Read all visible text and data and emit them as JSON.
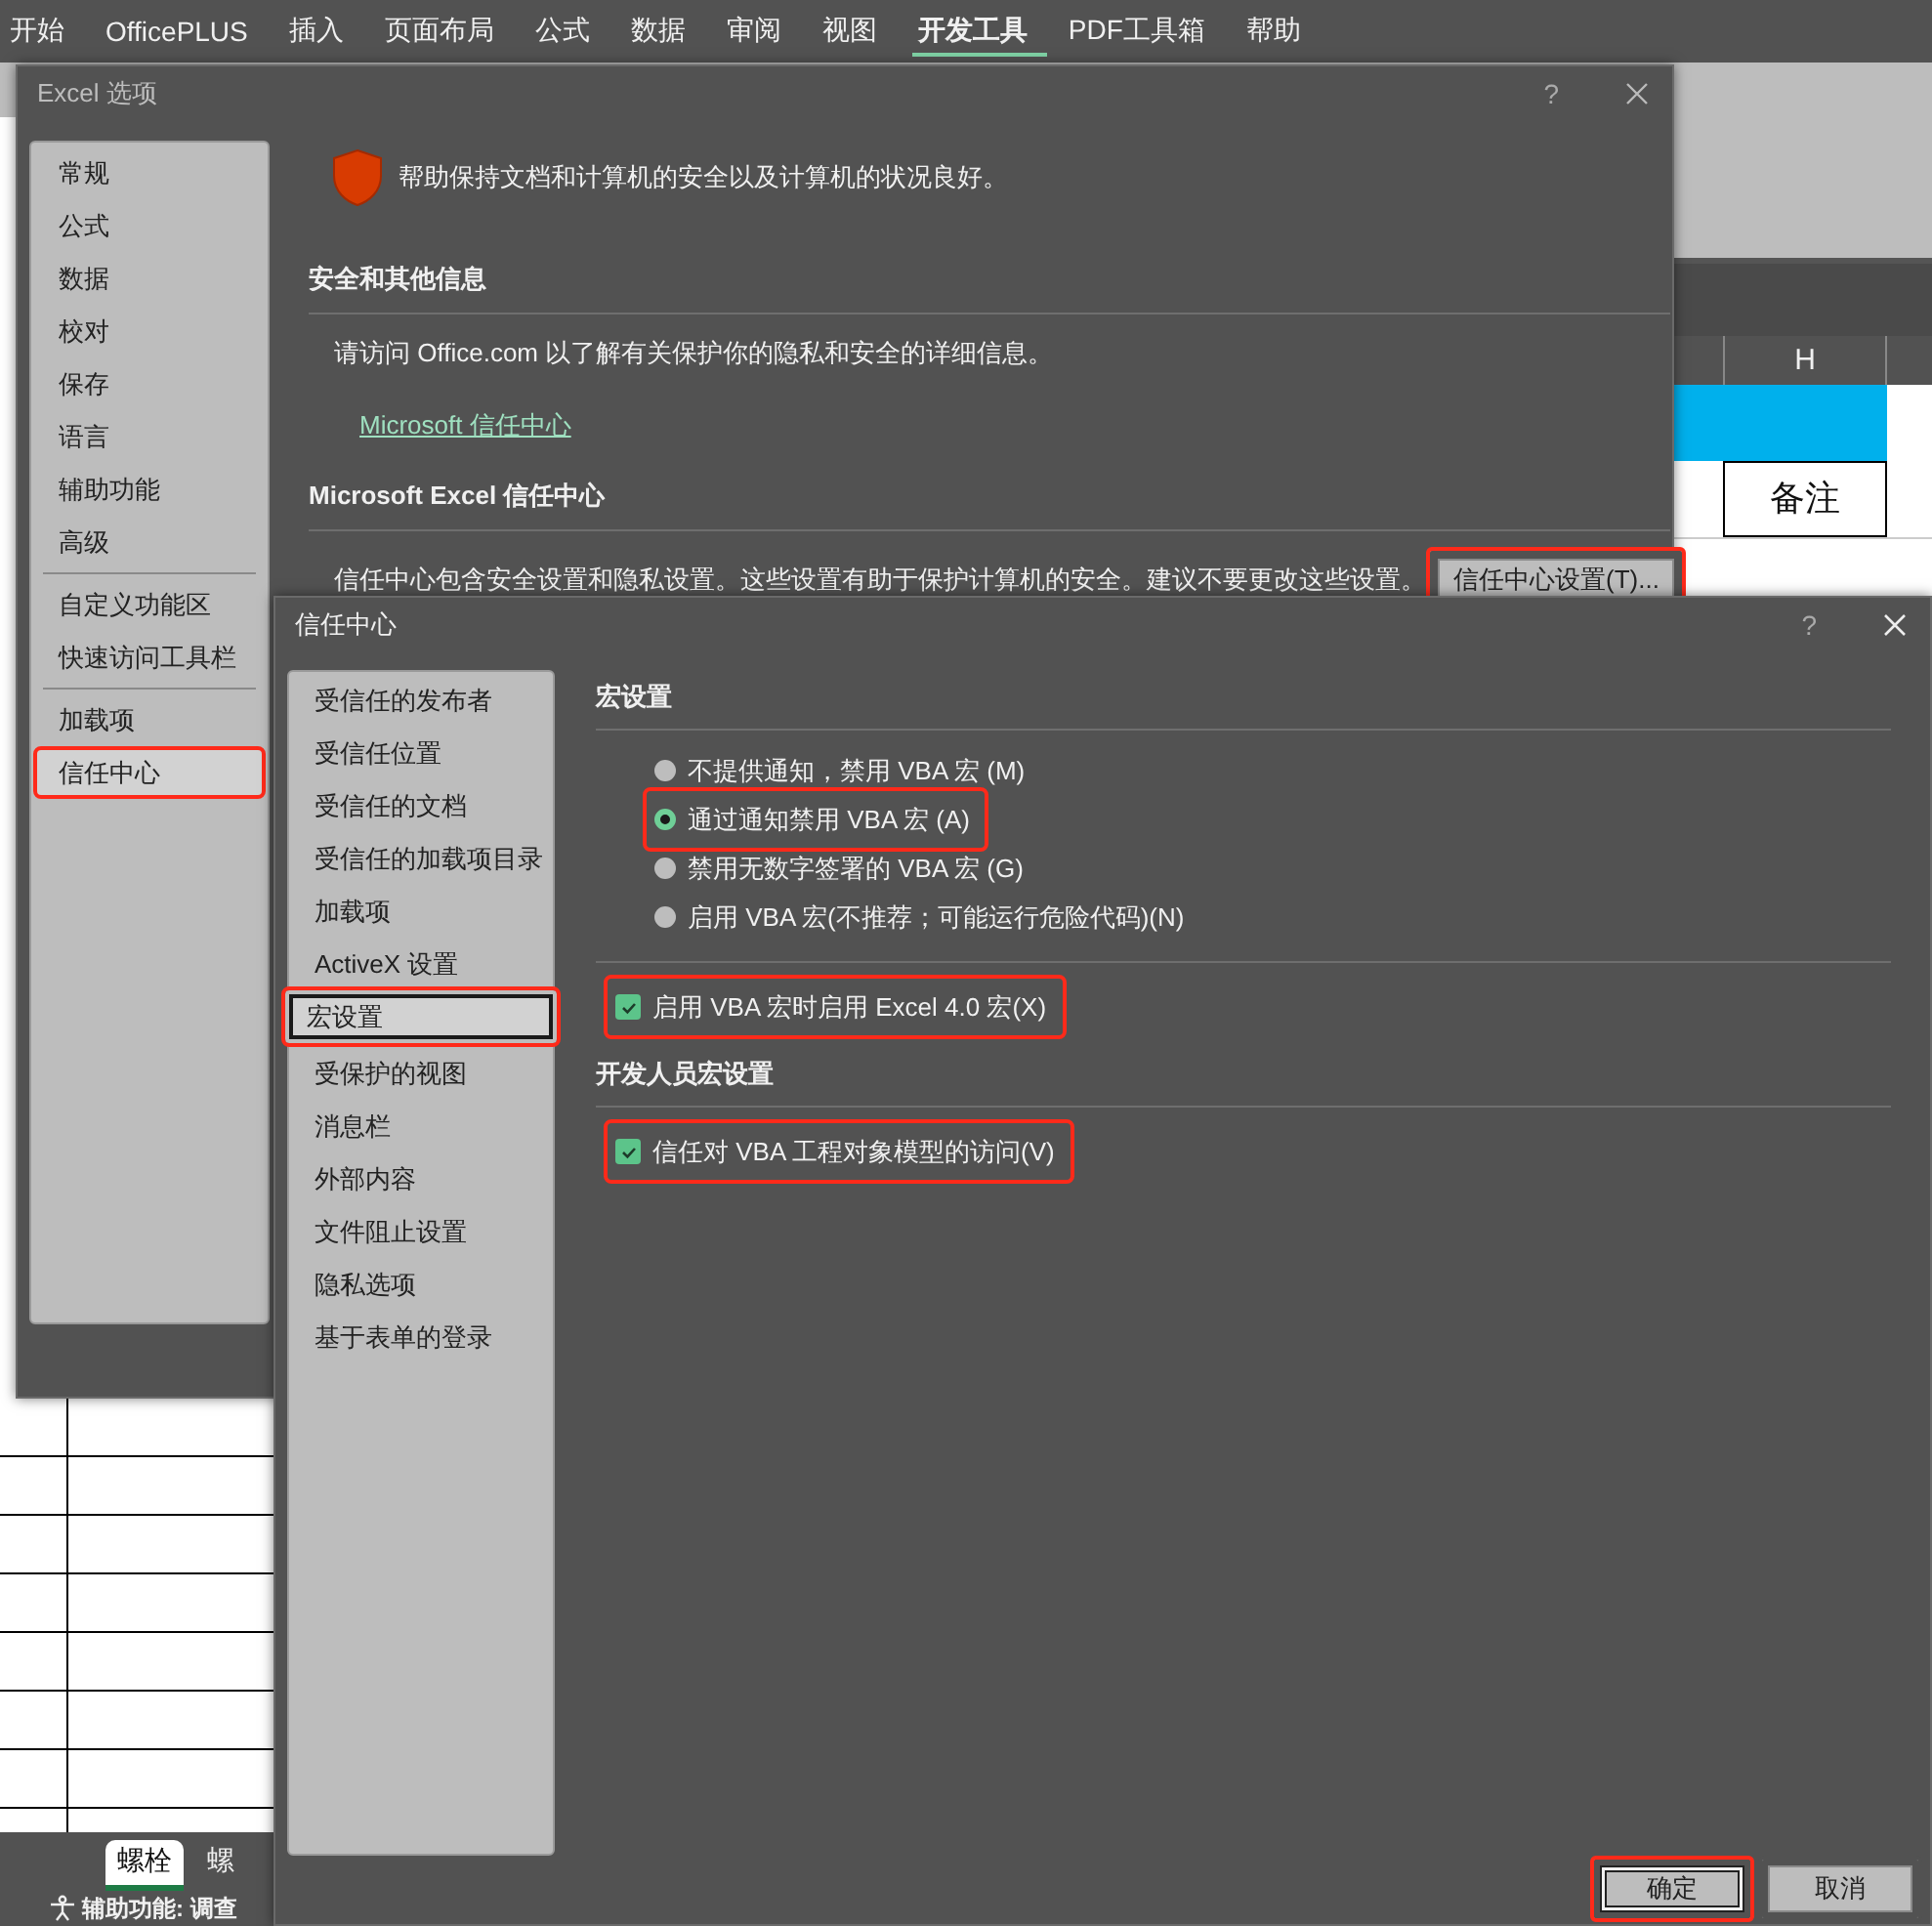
{
  "ribbon": {
    "tabs": [
      {
        "label": "开始",
        "selected": false
      },
      {
        "label": "OfficePLUS",
        "selected": false
      },
      {
        "label": "插入",
        "selected": false
      },
      {
        "label": "页面布局",
        "selected": false
      },
      {
        "label": "公式",
        "selected": false
      },
      {
        "label": "数据",
        "selected": false
      },
      {
        "label": "审阅",
        "selected": false
      },
      {
        "label": "视图",
        "selected": false
      },
      {
        "label": "开发工具",
        "selected": true
      },
      {
        "label": "PDF工具箱",
        "selected": false
      },
      {
        "label": "帮助",
        "selected": false
      }
    ]
  },
  "sheet": {
    "column_header": "H",
    "cell": "备注",
    "sheet_tabs": [
      {
        "label": "螺栓",
        "selected": true
      },
      {
        "label": "螺",
        "selected": false
      }
    ],
    "status_bar": "辅助功能: 调查"
  },
  "excel_options": {
    "title": "Excel 选项",
    "help": "?",
    "nav": [
      {
        "label": "常规",
        "selected": false,
        "highlighted": false,
        "separator_before": false
      },
      {
        "label": "公式",
        "selected": false,
        "highlighted": false,
        "separator_before": false
      },
      {
        "label": "数据",
        "selected": false,
        "highlighted": false,
        "separator_before": false
      },
      {
        "label": "校对",
        "selected": false,
        "highlighted": false,
        "separator_before": false
      },
      {
        "label": "保存",
        "selected": false,
        "highlighted": false,
        "separator_before": false
      },
      {
        "label": "语言",
        "selected": false,
        "highlighted": false,
        "separator_before": false
      },
      {
        "label": "辅助功能",
        "selected": false,
        "highlighted": false,
        "separator_before": false
      },
      {
        "label": "高级",
        "selected": false,
        "highlighted": false,
        "separator_before": false
      },
      {
        "label": "自定义功能区",
        "selected": false,
        "highlighted": false,
        "separator_before": true
      },
      {
        "label": "快速访问工具栏",
        "selected": false,
        "highlighted": false,
        "separator_before": false
      },
      {
        "label": "加载项",
        "selected": false,
        "highlighted": false,
        "separator_before": true
      },
      {
        "label": "信任中心",
        "selected": true,
        "highlighted": true,
        "separator_before": false
      }
    ],
    "banner": "帮助保持文档和计算机的安全以及计算机的状况良好。",
    "sections": [
      {
        "heading": "安全和其他信息",
        "text": "请访问 Office.com  以了解有关保护你的隐私和安全的详细信息。",
        "link": "Microsoft 信任中心"
      },
      {
        "heading": "Microsoft Excel 信任中心",
        "text": "信任中心包含安全设置和隐私设置。这些设置有助于保护计算机的安全。建议不要更改这些设置。",
        "button": {
          "label": "信任中心设置(T)...",
          "highlighted": true
        }
      }
    ]
  },
  "trust_center": {
    "title": "信任中心",
    "help": "?",
    "nav": [
      {
        "label": "受信任的发布者",
        "selected": false,
        "highlighted": false
      },
      {
        "label": "受信任位置",
        "selected": false,
        "highlighted": false
      },
      {
        "label": "受信任的文档",
        "selected": false,
        "highlighted": false
      },
      {
        "label": "受信任的加载项目录",
        "selected": false,
        "highlighted": false
      },
      {
        "label": "加载项",
        "selected": false,
        "highlighted": false
      },
      {
        "label": "ActiveX 设置",
        "selected": false,
        "highlighted": false
      },
      {
        "label": "宏设置",
        "selected": true,
        "highlighted": true
      },
      {
        "label": "受保护的视图",
        "selected": false,
        "highlighted": false
      },
      {
        "label": "消息栏",
        "selected": false,
        "highlighted": false
      },
      {
        "label": "外部内容",
        "selected": false,
        "highlighted": false
      },
      {
        "label": "文件阻止设置",
        "selected": false,
        "highlighted": false
      },
      {
        "label": "隐私选项",
        "selected": false,
        "highlighted": false
      },
      {
        "label": "基于表单的登录",
        "selected": false,
        "highlighted": false
      }
    ],
    "sections": [
      {
        "heading": "宏设置",
        "options": [
          {
            "kind": "radio",
            "label": "不提供通知，禁用 VBA 宏 (M)",
            "selected": false,
            "highlighted": false
          },
          {
            "kind": "radio",
            "label": "通过通知禁用 VBA 宏 (A)",
            "selected": true,
            "highlighted": true
          },
          {
            "kind": "radio",
            "label": "禁用无数字签署的 VBA 宏 (G)",
            "selected": false,
            "highlighted": false
          },
          {
            "kind": "radio",
            "label": "启用 VBA 宏(不推荐；可能运行危险代码)(N)",
            "selected": false,
            "highlighted": false
          },
          {
            "kind": "checkbox",
            "label": "启用 VBA 宏时启用 Excel 4.0 宏(X)",
            "checked": true,
            "highlighted": true
          }
        ]
      },
      {
        "heading": "开发人员宏设置",
        "options": [
          {
            "kind": "checkbox",
            "label": "信任对 VBA 工程对象模型的访问(V)",
            "checked": true,
            "highlighted": true
          }
        ]
      }
    ],
    "buttons": [
      {
        "label": "确定",
        "default": true,
        "highlighted": true
      },
      {
        "label": "取消",
        "default": false,
        "highlighted": false
      }
    ]
  }
}
